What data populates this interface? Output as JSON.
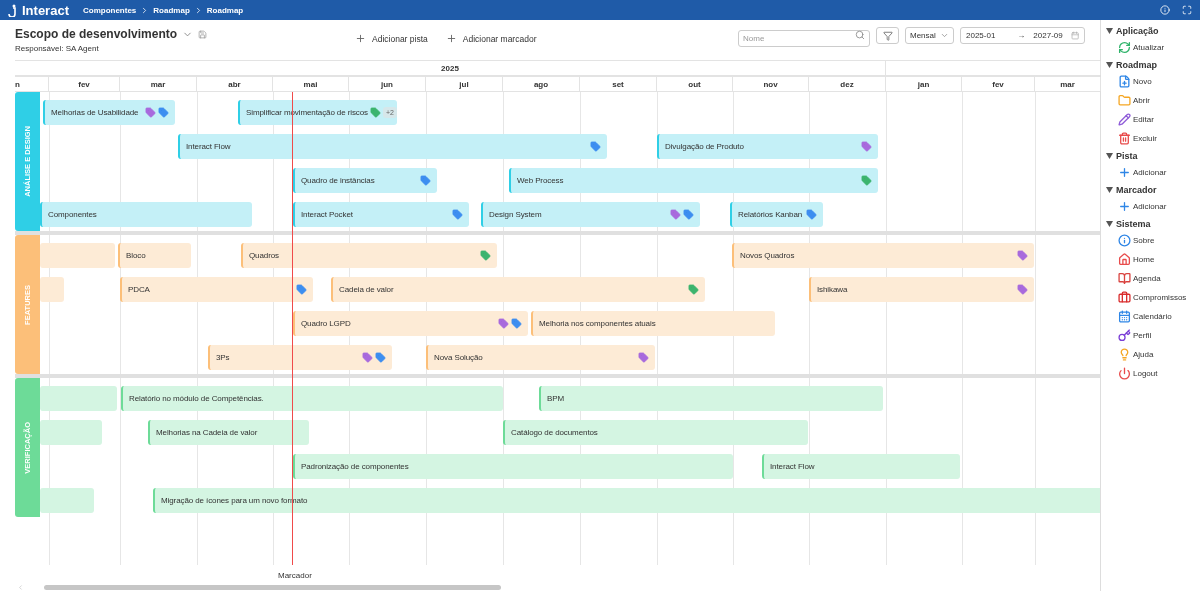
{
  "topbar": {
    "logo": "Interact",
    "breadcrumbs": [
      "Componentes",
      "Roadmap",
      "Roadmap"
    ]
  },
  "header": {
    "title": "Escopo de desenvolvimento",
    "owner": "Responsável: SA Agent",
    "actions": [
      "Adicionar pista",
      "Adicionar marcador"
    ],
    "search": {
      "placeholder": "Nome"
    },
    "view": "Mensal",
    "date_from": "2025-01",
    "date_arrow": "→",
    "date_to": "2027-09"
  },
  "years": [
    "2025"
  ],
  "months": [
    "n",
    "fev",
    "mar",
    "abr",
    "mai",
    "jun",
    "jul",
    "ago",
    "set",
    "out",
    "nov",
    "dez",
    "jan",
    "fev",
    "mar"
  ],
  "lanes": [
    {
      "name": "ANÁLISE E DESIGN",
      "color": "#2fcfe6",
      "items": [
        {
          "title": "Melhorias de Usabilidade",
          "tags": [
            {
              "color": "#a86add"
            },
            {
              "color": "#3d8ef0"
            }
          ]
        },
        {
          "title": "Simplificar movimentação de riscos",
          "tags": [
            {
              "color": "#3cb46e"
            }
          ],
          "more": "+2"
        },
        {
          "title": "Interact Flow",
          "tags": [
            {
              "color": "#3d8ef0"
            }
          ]
        },
        {
          "title": "Divulgação de Produto",
          "tags": [
            {
              "color": "#a86add"
            }
          ]
        },
        {
          "title": "Quadro de instâncias",
          "tags": [
            {
              "color": "#3d8ef0"
            }
          ]
        },
        {
          "title": "Web Process",
          "tags": [
            {
              "color": "#3cb46e"
            }
          ]
        },
        {
          "title": "Componentes"
        },
        {
          "title": "Interact Pocket",
          "tags": [
            {
              "color": "#3d8ef0"
            }
          ]
        },
        {
          "title": "Design System",
          "tags": [
            {
              "color": "#a86add"
            },
            {
              "color": "#3d8ef0"
            }
          ]
        },
        {
          "title": "Relatórios Kanban",
          "tags": [
            {
              "color": "#3d8ef0"
            }
          ]
        }
      ]
    },
    {
      "name": "FEATURES",
      "color": "#fcbf79",
      "items": [
        {
          "blank": true
        },
        {
          "title": "Bloco"
        },
        {
          "title": "Quadros",
          "tags": [
            {
              "color": "#3cb46e"
            }
          ]
        },
        {
          "title": "Novos Quadros",
          "tags": [
            {
              "color": "#a86add"
            }
          ]
        },
        {
          "blank": true
        },
        {
          "title": "PDCA",
          "tags": [
            {
              "color": "#3d8ef0"
            }
          ]
        },
        {
          "title": "Cadeia de valor",
          "tags": [
            {
              "color": "#3cb46e"
            }
          ]
        },
        {
          "title": "Ishikawa",
          "tags": [
            {
              "color": "#a86add"
            }
          ]
        },
        {
          "title": "Quadro LGPD",
          "tags": [
            {
              "color": "#a86add"
            },
            {
              "color": "#3d8ef0"
            }
          ]
        },
        {
          "title": "Melhoria nos componentes atuais"
        },
        {
          "title": "3Ps",
          "tags": [
            {
              "color": "#a86add"
            },
            {
              "color": "#3d8ef0"
            }
          ]
        },
        {
          "title": "Nova Solução",
          "tags": [
            {
              "color": "#a86add"
            }
          ]
        }
      ]
    },
    {
      "name": "VERIFICAÇÃO",
      "color": "#6ddb98",
      "items": [
        {
          "blank": true
        },
        {
          "title": "Relatório no módulo de Competências."
        },
        {
          "title": "BPM"
        },
        {
          "blank": true
        },
        {
          "title": "Melhorias na Cadeia de valor"
        },
        {
          "title": "Catálogo de documentos"
        },
        {
          "title": "Padronização de componentes"
        },
        {
          "title": "Interact Flow"
        },
        {
          "blank": true
        },
        {
          "title": "Migração de ícones para um novo formato"
        }
      ]
    }
  ],
  "marker": {
    "label": "Marcador"
  },
  "sidebar": [
    {
      "title": "Aplicação",
      "expanded": true,
      "items": [
        "Atualizar"
      ]
    },
    {
      "title": "Roadmap",
      "expanded": true,
      "items": [
        "Novo",
        "Abrir",
        "Editar",
        "Excluir"
      ]
    },
    {
      "title": "Pista",
      "expanded": true,
      "items": [
        "Adicionar"
      ]
    },
    {
      "title": "Marcador",
      "expanded": true,
      "items": [
        "Adicionar"
      ]
    },
    {
      "title": "Sistema",
      "expanded": true,
      "items": [
        "Sobre",
        "Home",
        "Agenda",
        "Compromissos",
        "Calendário",
        "Perfil",
        "Ajuda",
        "Logout"
      ]
    }
  ]
}
